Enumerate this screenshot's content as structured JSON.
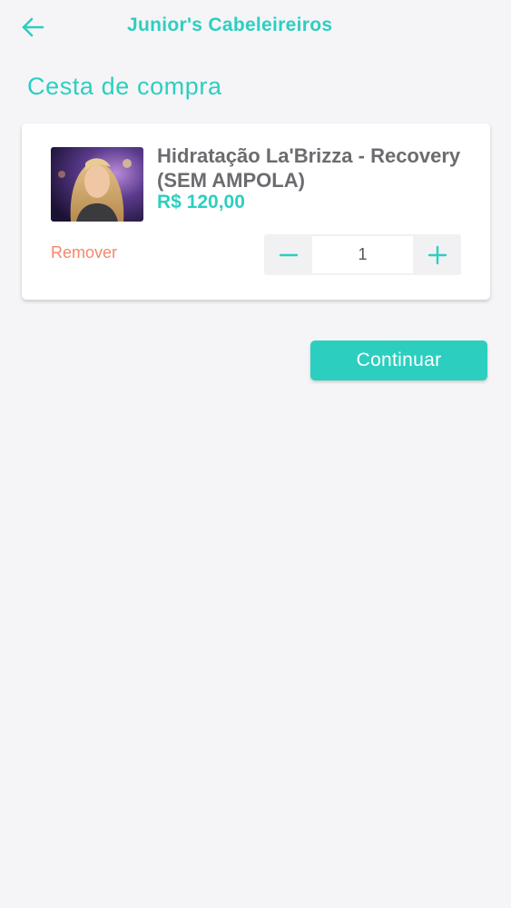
{
  "header": {
    "back_icon": "arrow-left-icon",
    "title": "Junior's Cabeleireiros"
  },
  "page": {
    "title": "Cesta de compra"
  },
  "cart": {
    "items": [
      {
        "image_icon": "product-photo",
        "name": "Hidratação La'Brizza - Recovery (SEM AMPOLA)",
        "price": "R$ 120,00",
        "remove_label": "Remover",
        "quantity": "1",
        "minus_icon": "minus-icon",
        "plus_icon": "plus-icon"
      }
    ]
  },
  "actions": {
    "continue_label": "Continuar"
  },
  "colors": {
    "accent": "#2ccfbf",
    "remove": "#f4876a",
    "text_dark": "#6e6b70",
    "background": "#f5f5f8"
  }
}
